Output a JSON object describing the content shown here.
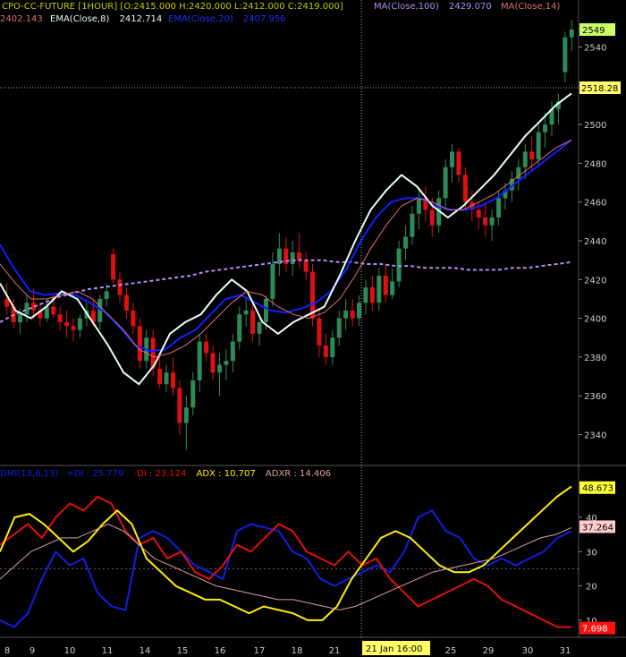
{
  "header": {
    "ohlc_text": "CPO-CC-FUTURE [1HOUR] [O:2415.000  H:2420.000  L:2412.000  C:2419.000]",
    "ma100_label": "MA(Close,100)",
    "ma100_value": "2429.070",
    "ma14_label": "MA(Close,14)",
    "ma14_value": "2402.143",
    "ema8_label": "EMA(Close,8)",
    "ema8_value": "2412.714",
    "ema20_label": "EMA(Close,20)",
    "ema20_value": "2407.956"
  },
  "indicator_header": {
    "dmi_label": "DMI(13,6,13)",
    "pdi_label": "+DI :",
    "pdi_value": "25.779",
    "mdi_label": "-DI :",
    "mdi_value": "23.124",
    "adx_label": "ADX :",
    "adx_value": "10.707",
    "adxr_label": "ADXR :",
    "adxr_value": "14.406"
  },
  "crosshair": {
    "date_label": "21 Jan 16:00",
    "price_label": "2518.28"
  },
  "colors": {
    "background": "#000000",
    "bull_candle": "#2e8b57",
    "bear_candle": "#e01010",
    "ema8": "#e8fff8",
    "ema20": "#1020ff",
    "ma14": "#e07070",
    "ma100": "#b58cf0",
    "pdi": "#1020e0",
    "mdi": "#e01010",
    "adx": "#ffef00",
    "adxr": "#e0a0a0",
    "axis_text": "#cccccc",
    "grid": "#333333"
  },
  "chart_data": [
    {
      "type": "candlestick",
      "title": "CPO-CC-FUTURE [1HOUR]",
      "x_tick_labels": [
        "8",
        "9",
        "10",
        "11",
        "14",
        "15",
        "16",
        "17",
        "18",
        "21",
        "22",
        "25",
        "29",
        "30",
        "31"
      ],
      "y_ticks": [
        2340,
        2360,
        2380,
        2400,
        2420,
        2440,
        2460,
        2480,
        2500,
        2520,
        2540
      ],
      "ylim": [
        2325,
        2555
      ],
      "last_price_tag": "2549",
      "candles": [
        {
          "o": 2410,
          "h": 2418,
          "l": 2402,
          "c": 2406
        },
        {
          "o": 2406,
          "h": 2410,
          "l": 2395,
          "c": 2398
        },
        {
          "o": 2398,
          "h": 2405,
          "l": 2392,
          "c": 2402
        },
        {
          "o": 2402,
          "h": 2412,
          "l": 2398,
          "c": 2408
        },
        {
          "o": 2408,
          "h": 2415,
          "l": 2400,
          "c": 2404
        },
        {
          "o": 2404,
          "h": 2408,
          "l": 2396,
          "c": 2400
        },
        {
          "o": 2400,
          "h": 2410,
          "l": 2398,
          "c": 2406
        },
        {
          "o": 2406,
          "h": 2412,
          "l": 2400,
          "c": 2402
        },
        {
          "o": 2402,
          "h": 2406,
          "l": 2394,
          "c": 2398
        },
        {
          "o": 2398,
          "h": 2404,
          "l": 2390,
          "c": 2396
        },
        {
          "o": 2396,
          "h": 2400,
          "l": 2388,
          "c": 2394
        },
        {
          "o": 2394,
          "h": 2402,
          "l": 2390,
          "c": 2400
        },
        {
          "o": 2400,
          "h": 2408,
          "l": 2396,
          "c": 2404
        },
        {
          "o": 2404,
          "h": 2410,
          "l": 2396,
          "c": 2398
        },
        {
          "o": 2398,
          "h": 2412,
          "l": 2394,
          "c": 2410
        },
        {
          "o": 2410,
          "h": 2418,
          "l": 2406,
          "c": 2414
        },
        {
          "o": 2433,
          "h": 2436,
          "l": 2418,
          "c": 2420
        },
        {
          "o": 2420,
          "h": 2424,
          "l": 2408,
          "c": 2412
        },
        {
          "o": 2412,
          "h": 2416,
          "l": 2400,
          "c": 2404
        },
        {
          "o": 2404,
          "h": 2408,
          "l": 2392,
          "c": 2396
        },
        {
          "o": 2396,
          "h": 2400,
          "l": 2374,
          "c": 2378
        },
        {
          "o": 2378,
          "h": 2394,
          "l": 2374,
          "c": 2390
        },
        {
          "o": 2390,
          "h": 2394,
          "l": 2370,
          "c": 2374
        },
        {
          "o": 2374,
          "h": 2382,
          "l": 2364,
          "c": 2366
        },
        {
          "o": 2366,
          "h": 2376,
          "l": 2362,
          "c": 2372
        },
        {
          "o": 2372,
          "h": 2380,
          "l": 2360,
          "c": 2364
        },
        {
          "o": 2364,
          "h": 2368,
          "l": 2340,
          "c": 2346
        },
        {
          "o": 2346,
          "h": 2360,
          "l": 2332,
          "c": 2354
        },
        {
          "o": 2354,
          "h": 2372,
          "l": 2350,
          "c": 2368
        },
        {
          "o": 2368,
          "h": 2392,
          "l": 2362,
          "c": 2388
        },
        {
          "o": 2388,
          "h": 2392,
          "l": 2378,
          "c": 2382
        },
        {
          "o": 2382,
          "h": 2386,
          "l": 2368,
          "c": 2372
        },
        {
          "o": 2372,
          "h": 2382,
          "l": 2360,
          "c": 2376
        },
        {
          "o": 2376,
          "h": 2384,
          "l": 2368,
          "c": 2378
        },
        {
          "o": 2378,
          "h": 2392,
          "l": 2372,
          "c": 2388
        },
        {
          "o": 2388,
          "h": 2406,
          "l": 2384,
          "c": 2402
        },
        {
          "o": 2402,
          "h": 2410,
          "l": 2396,
          "c": 2404
        },
        {
          "o": 2404,
          "h": 2408,
          "l": 2388,
          "c": 2392
        },
        {
          "o": 2392,
          "h": 2402,
          "l": 2386,
          "c": 2398
        },
        {
          "o": 2398,
          "h": 2412,
          "l": 2394,
          "c": 2410
        },
        {
          "o": 2410,
          "h": 2434,
          "l": 2406,
          "c": 2428
        },
        {
          "o": 2428,
          "h": 2444,
          "l": 2422,
          "c": 2436
        },
        {
          "o": 2436,
          "h": 2442,
          "l": 2424,
          "c": 2428
        },
        {
          "o": 2428,
          "h": 2440,
          "l": 2422,
          "c": 2434
        },
        {
          "o": 2434,
          "h": 2444,
          "l": 2426,
          "c": 2430
        },
        {
          "o": 2430,
          "h": 2434,
          "l": 2420,
          "c": 2424
        },
        {
          "o": 2424,
          "h": 2428,
          "l": 2396,
          "c": 2400
        },
        {
          "o": 2400,
          "h": 2404,
          "l": 2380,
          "c": 2386
        },
        {
          "o": 2386,
          "h": 2392,
          "l": 2376,
          "c": 2380
        },
        {
          "o": 2380,
          "h": 2394,
          "l": 2376,
          "c": 2390
        },
        {
          "o": 2390,
          "h": 2404,
          "l": 2386,
          "c": 2400
        },
        {
          "o": 2400,
          "h": 2410,
          "l": 2394,
          "c": 2404
        },
        {
          "o": 2404,
          "h": 2410,
          "l": 2396,
          "c": 2400
        },
        {
          "o": 2400,
          "h": 2412,
          "l": 2396,
          "c": 2408
        },
        {
          "o": 2408,
          "h": 2420,
          "l": 2402,
          "c": 2416
        },
        {
          "o": 2416,
          "h": 2422,
          "l": 2404,
          "c": 2408
        },
        {
          "o": 2408,
          "h": 2426,
          "l": 2404,
          "c": 2422
        },
        {
          "o": 2422,
          "h": 2428,
          "l": 2408,
          "c": 2412
        },
        {
          "o": 2412,
          "h": 2426,
          "l": 2410,
          "c": 2419
        },
        {
          "o": 2419,
          "h": 2440,
          "l": 2416,
          "c": 2436
        },
        {
          "o": 2436,
          "h": 2448,
          "l": 2430,
          "c": 2442
        },
        {
          "o": 2442,
          "h": 2458,
          "l": 2438,
          "c": 2454
        },
        {
          "o": 2454,
          "h": 2466,
          "l": 2446,
          "c": 2462
        },
        {
          "o": 2462,
          "h": 2468,
          "l": 2450,
          "c": 2456
        },
        {
          "o": 2456,
          "h": 2462,
          "l": 2442,
          "c": 2448
        },
        {
          "o": 2448,
          "h": 2466,
          "l": 2444,
          "c": 2462
        },
        {
          "o": 2462,
          "h": 2482,
          "l": 2456,
          "c": 2478
        },
        {
          "o": 2478,
          "h": 2490,
          "l": 2470,
          "c": 2486
        },
        {
          "o": 2486,
          "h": 2488,
          "l": 2470,
          "c": 2474
        },
        {
          "o": 2474,
          "h": 2478,
          "l": 2456,
          "c": 2460
        },
        {
          "o": 2460,
          "h": 2466,
          "l": 2450,
          "c": 2456
        },
        {
          "o": 2456,
          "h": 2460,
          "l": 2446,
          "c": 2452
        },
        {
          "o": 2452,
          "h": 2460,
          "l": 2442,
          "c": 2448
        },
        {
          "o": 2448,
          "h": 2456,
          "l": 2440,
          "c": 2452
        },
        {
          "o": 2452,
          "h": 2466,
          "l": 2448,
          "c": 2462
        },
        {
          "o": 2462,
          "h": 2470,
          "l": 2456,
          "c": 2466
        },
        {
          "o": 2466,
          "h": 2476,
          "l": 2460,
          "c": 2472
        },
        {
          "o": 2472,
          "h": 2482,
          "l": 2466,
          "c": 2478
        },
        {
          "o": 2478,
          "h": 2490,
          "l": 2472,
          "c": 2486
        },
        {
          "o": 2486,
          "h": 2494,
          "l": 2476,
          "c": 2482
        },
        {
          "o": 2482,
          "h": 2500,
          "l": 2478,
          "c": 2496
        },
        {
          "o": 2496,
          "h": 2506,
          "l": 2488,
          "c": 2500
        },
        {
          "o": 2500,
          "h": 2512,
          "l": 2494,
          "c": 2508
        },
        {
          "o": 2508,
          "h": 2516,
          "l": 2500,
          "c": 2512
        },
        {
          "o": 2527,
          "h": 2548,
          "l": 2522,
          "c": 2545
        },
        {
          "o": 2545,
          "h": 2554,
          "l": 2538,
          "c": 2549
        }
      ],
      "series": [
        {
          "name": "MA(Close,100)",
          "values": [
            2398,
            2402,
            2405,
            2408,
            2411,
            2413,
            2415,
            2416,
            2417,
            2418,
            2419,
            2420,
            2421,
            2422,
            2424,
            2425,
            2426,
            2427,
            2428,
            2429,
            2430,
            2430,
            2430,
            2429,
            2429,
            2428,
            2428,
            2427,
            2427,
            2426,
            2426,
            2426,
            2425,
            2425,
            2425,
            2426,
            2426,
            2427,
            2428,
            2429
          ]
        },
        {
          "name": "EMA(Close,20)",
          "values": [
            2438,
            2425,
            2414,
            2412,
            2413,
            2412,
            2408,
            2403,
            2395,
            2386,
            2383,
            2384,
            2390,
            2394,
            2402,
            2410,
            2412,
            2408,
            2404,
            2403,
            2405,
            2408,
            2414,
            2425,
            2440,
            2452,
            2460,
            2462,
            2462,
            2458,
            2456,
            2456,
            2458,
            2462,
            2468,
            2474,
            2480,
            2486,
            2492
          ]
        },
        {
          "name": "EMA(Close,8)",
          "values": [
            2418,
            2404,
            2400,
            2406,
            2414,
            2410,
            2398,
            2386,
            2372,
            2366,
            2376,
            2392,
            2398,
            2402,
            2412,
            2420,
            2414,
            2398,
            2392,
            2398,
            2402,
            2406,
            2422,
            2440,
            2456,
            2466,
            2474,
            2468,
            2458,
            2452,
            2458,
            2466,
            2474,
            2484,
            2494,
            2502,
            2510,
            2516
          ]
        },
        {
          "name": "MA(Close,14)",
          "values": [
            2428,
            2418,
            2410,
            2410,
            2412,
            2414,
            2410,
            2402,
            2394,
            2384,
            2380,
            2382,
            2386,
            2392,
            2400,
            2408,
            2414,
            2412,
            2406,
            2402,
            2400,
            2403,
            2410,
            2422,
            2436,
            2448,
            2458,
            2462,
            2460,
            2456,
            2456,
            2460,
            2464,
            2470,
            2476,
            2482,
            2488,
            2492
          ]
        }
      ]
    },
    {
      "type": "line",
      "title": "DMI(13,6,13)",
      "y_ticks": [
        10,
        20,
        30,
        40
      ],
      "ylim": [
        5,
        52
      ],
      "value_tags": [
        "48.673",
        "37.264",
        "7.698"
      ],
      "series": [
        {
          "name": "+DI",
          "values": [
            10,
            8,
            12,
            22,
            30,
            26,
            28,
            18,
            14,
            13,
            34,
            36,
            34,
            30,
            26,
            24,
            22,
            36,
            38,
            37,
            36,
            30,
            28,
            22,
            20,
            22,
            24,
            26,
            24,
            30,
            40,
            42,
            36,
            34,
            28,
            26,
            28,
            26,
            28,
            30,
            34,
            36
          ]
        },
        {
          "name": "-DI",
          "values": [
            32,
            35,
            38,
            34,
            40,
            44,
            42,
            46,
            44,
            36,
            32,
            34,
            28,
            30,
            24,
            22,
            26,
            32,
            30,
            34,
            38,
            36,
            30,
            28,
            26,
            30,
            26,
            28,
            22,
            18,
            14,
            16,
            18,
            20,
            22,
            20,
            16,
            14,
            12,
            10,
            8,
            8
          ]
        },
        {
          "name": "ADX",
          "values": [
            30,
            40,
            41,
            38,
            34,
            30,
            33,
            38,
            42,
            38,
            28,
            24,
            20,
            18,
            16,
            16,
            14,
            12,
            14,
            13,
            12,
            10,
            10,
            14,
            22,
            28,
            34,
            36,
            34,
            30,
            26,
            24,
            24,
            26,
            30,
            34,
            38,
            42,
            46,
            49
          ]
        },
        {
          "name": "ADXR",
          "values": [
            22,
            26,
            30,
            32,
            34,
            34,
            36,
            38,
            36,
            32,
            28,
            26,
            24,
            22,
            20,
            19,
            18,
            17,
            16,
            16,
            15,
            14,
            13,
            14,
            16,
            18,
            20,
            22,
            24,
            25,
            26,
            27,
            28,
            30,
            32,
            34,
            35,
            37
          ]
        }
      ]
    }
  ]
}
